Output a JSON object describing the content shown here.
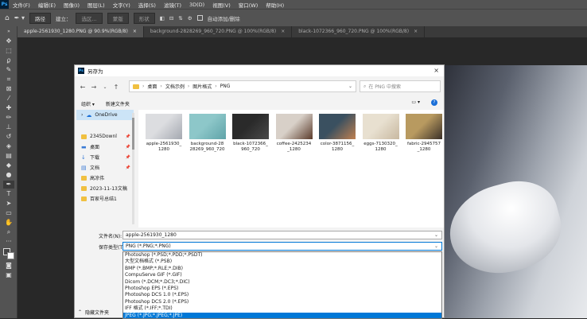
{
  "menubar": {
    "logo": "Ps",
    "items": [
      "文件(F)",
      "编辑(E)",
      "图像(I)",
      "图层(L)",
      "文字(Y)",
      "选择(S)",
      "滤镜(T)",
      "3D(D)",
      "视图(V)",
      "窗口(W)",
      "帮助(H)"
    ]
  },
  "options": {
    "mode": "路径",
    "build": "建立：",
    "selection": "选区...",
    "mask": "蒙版",
    "shape": "形状",
    "auto_add_delete": "自动添加/删除"
  },
  "tabs": [
    {
      "label": "apple-2561930_1280.PNG @ 90.9%(RGB/8)",
      "close": "×"
    },
    {
      "label": "background-2828269_960_720.PNG @ 100%(RGB/8)",
      "close": "×"
    },
    {
      "label": "black-1072366_960_720.PNG @ 100%(RGB/8)",
      "close": "×"
    }
  ],
  "dialog": {
    "title": "另存为",
    "close": "×",
    "breadcrumb": [
      "桌面",
      "文档示例",
      "图片格式",
      "PNG"
    ],
    "search_placeholder": "在 PNG 中搜索",
    "organize": "组织 ▾",
    "new_folder": "新建文件夹",
    "help": "?",
    "nav": [
      {
        "label": "OneDrive",
        "selected": true,
        "pin": false,
        "icon": "cloud-icon"
      },
      {
        "label": "2345Downl",
        "selected": false,
        "pin": true,
        "icon": "folder-icon"
      },
      {
        "label": "桌面",
        "selected": false,
        "pin": true,
        "icon": "desktop-icon"
      },
      {
        "label": "下载",
        "selected": false,
        "pin": true,
        "icon": "download-icon"
      },
      {
        "label": "文档",
        "selected": false,
        "pin": true,
        "icon": "document-icon"
      },
      {
        "label": "高凉伟",
        "selected": false,
        "pin": false,
        "icon": "folder-icon"
      },
      {
        "label": "2023-11-13文稿",
        "selected": false,
        "pin": false,
        "icon": "folder-icon"
      },
      {
        "label": "百家号总结1",
        "selected": false,
        "pin": false,
        "icon": "folder-icon"
      }
    ],
    "files": [
      {
        "name1": "apple-2561930_",
        "name2": "1280",
        "color": "#dcdde0",
        "color2": "#a4a8b0"
      },
      {
        "name1": "background-28",
        "name2": "28269_960_720",
        "color": "#8dc7c9",
        "color2": "#5fa3a8"
      },
      {
        "name1": "black-1072366_",
        "name2": "960_720",
        "color": "#2a2a2a",
        "color2": "#4a4a4a"
      },
      {
        "name1": "coffee-2425234",
        "name2": "_1280",
        "color": "#d8d0c8",
        "color2": "#5a3a2a"
      },
      {
        "name1": "color-3871156_",
        "name2": "1280",
        "color": "#3a5060",
        "color2": "#c08050"
      },
      {
        "name1": "eggs-7130320_",
        "name2": "1280",
        "color": "#e8e0d0",
        "color2": "#c8b8a0"
      },
      {
        "name1": "fabric-2945757",
        "name2": "_1280",
        "color": "#b89a60",
        "color2": "#3a3028"
      }
    ],
    "filename_label": "文件名(N):",
    "filename": "apple-2561930_1280",
    "filetype_label": "保存类型(T):",
    "filetype": "PNG (*.PNG;*.PNG)",
    "filetypes": [
      "Photoshop (*.PSD;*.PDD;*.PSDT)",
      "大型文档格式 (*.PSB)",
      "BMP (*.BMP;*.RLE;*.DIB)",
      "CompuServe GIF (*.GIF)",
      "Dicom (*.DCM;*.DC3;*.DIC)",
      "Photoshop EPS (*.EPS)",
      "Photoshop DCS 1.0 (*.EPS)",
      "Photoshop DCS 2.0 (*.EPS)",
      "IFF 格式 (*.IFF;*.TDI)",
      "JPEG (*.JPG;*.JPEG;*.JPE)"
    ],
    "filetypes_selected_index": 9,
    "hide_folders": "隐藏文件夹"
  }
}
